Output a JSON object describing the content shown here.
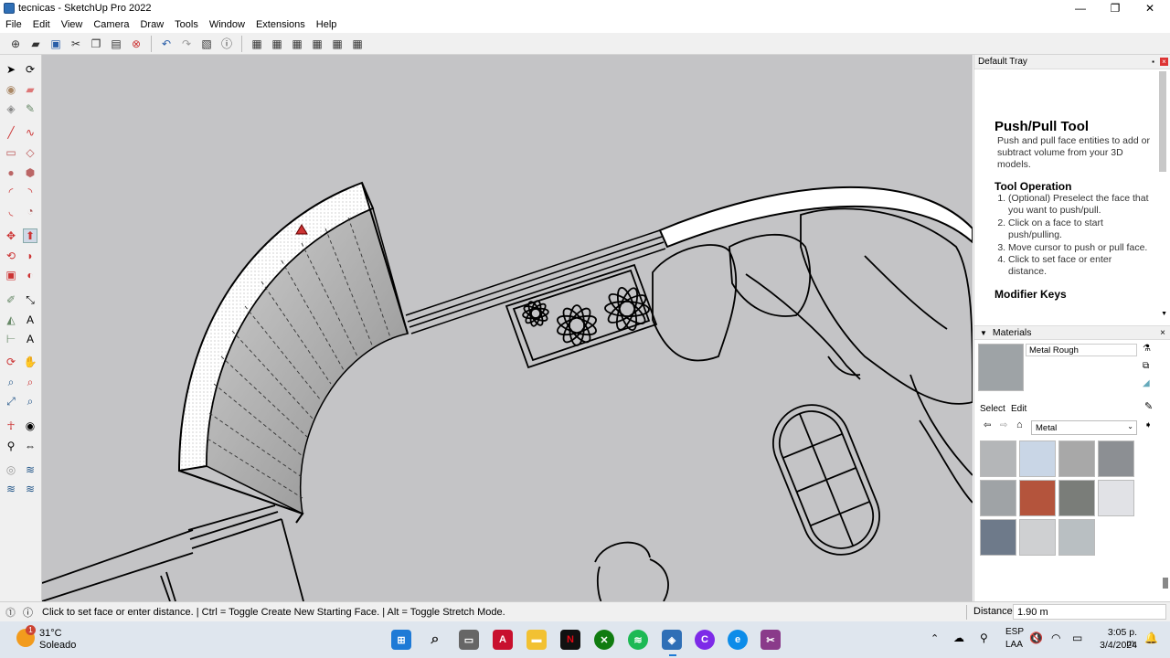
{
  "window": {
    "title": "tecnicas - SketchUp Pro 2022",
    "min": "—",
    "max": "❐",
    "close": "✕"
  },
  "menu": [
    "File",
    "Edit",
    "View",
    "Camera",
    "Draw",
    "Tools",
    "Window",
    "Extensions",
    "Help"
  ],
  "tray": {
    "title": "Default Tray",
    "instructor": {
      "heading": "Push/Pull Tool",
      "description": "Push and pull face entities to add or subtract volume from your 3D models.",
      "operation_heading": "Tool Operation",
      "steps": [
        "(Optional) Preselect the face that you want to push/pull.",
        "Click on a face to start push/pulling.",
        "Move cursor to push or pull face.",
        "Click to set face or enter distance."
      ],
      "modifier_heading": "Modifier Keys"
    },
    "materials": {
      "title": "Materials",
      "current_name": "Metal Rough",
      "tabs": [
        "Select",
        "Edit"
      ],
      "library": "Metal",
      "swatches": [
        "#b4b6b8",
        "#c9d6e6",
        "#a8a8a8",
        "#8c8f93",
        "#9fa3a6",
        "#b4543c",
        "#7a7d79",
        "#e1e2e6",
        "#6e7a8a",
        "#cfd0d2",
        "#b9bfc2"
      ]
    }
  },
  "status": {
    "hint": "Click to set face or enter distance. | Ctrl = Toggle Create New Starting Face. | Alt = Toggle Stretch Mode.",
    "measure_label": "Distance",
    "measure_value": "1.90 m"
  },
  "taskbar": {
    "weather_temp": "31°C",
    "weather_desc": "Soleado",
    "weather_badge": "1",
    "lang": "ESP",
    "layout": "LAA",
    "time": "3:05 p. m.",
    "date": "3/4/2024"
  }
}
